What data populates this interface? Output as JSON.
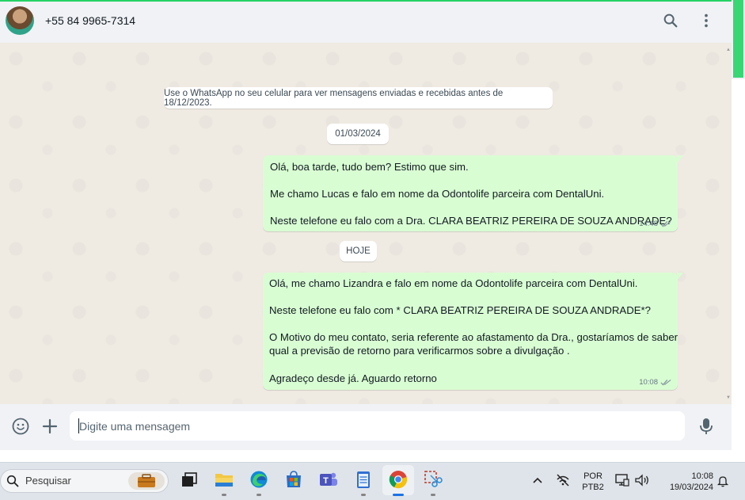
{
  "header": {
    "contact": "+55 84 9965-7314",
    "search_icon": "search-icon",
    "menu_icon": "kebab-menu-icon"
  },
  "chat": {
    "system_notice": "Use o WhatsApp no seu celular para ver mensagens enviadas e recebidas antes de 18/12/2023.",
    "date_1": "01/03/2024",
    "message_1": {
      "lines": [
        "Olá, boa tarde, tudo bem? Estimo que sim.",
        "Me chamo Lucas e falo em nome da Odontolife parceira com DentalUni.",
        "Neste telefone eu falo com a Dra. CLARA BEATRIZ PEREIRA DE SOUZA ANDRADE?"
      ],
      "time": "14:48",
      "status_icon": "double-check-icon"
    },
    "date_2": "HOJE",
    "message_2": {
      "lines": [
        "Olá, me chamo Lizandra e falo em nome da Odontolife parceira com DentalUni.",
        "Neste telefone eu falo com * CLARA BEATRIZ PEREIRA DE SOUZA ANDRADE*?",
        "O Motivo do meu contato, seria referente ao afastamento da Dra., gostaríamos de saber",
        "qual a previsão de retorno para verificarmos sobre a divulgação .",
        "Agradeço desde já. Aguardo retorno"
      ],
      "time": "10:08",
      "status_icon": "double-check-icon"
    }
  },
  "composer": {
    "placeholder": "Digite uma mensagem",
    "emoji_icon": "emoji-icon",
    "attach_icon": "plus-icon",
    "mic_icon": "microphone-icon"
  },
  "taskbar": {
    "search_label": "Pesquisar",
    "apps": [
      "task-view-icon",
      "file-explorer-icon",
      "edge-icon",
      "microsoft-store-icon",
      "teams-icon",
      "notepad-icon",
      "chrome-icon",
      "snipping-tool-icon"
    ],
    "language": "POR",
    "keyboard": "PTB2",
    "time": "10:08",
    "date": "19/03/2024"
  },
  "colors": {
    "accent": "#25d366",
    "outgoing_bubble": "#d9fdd3",
    "chat_bg": "#efeae2"
  }
}
